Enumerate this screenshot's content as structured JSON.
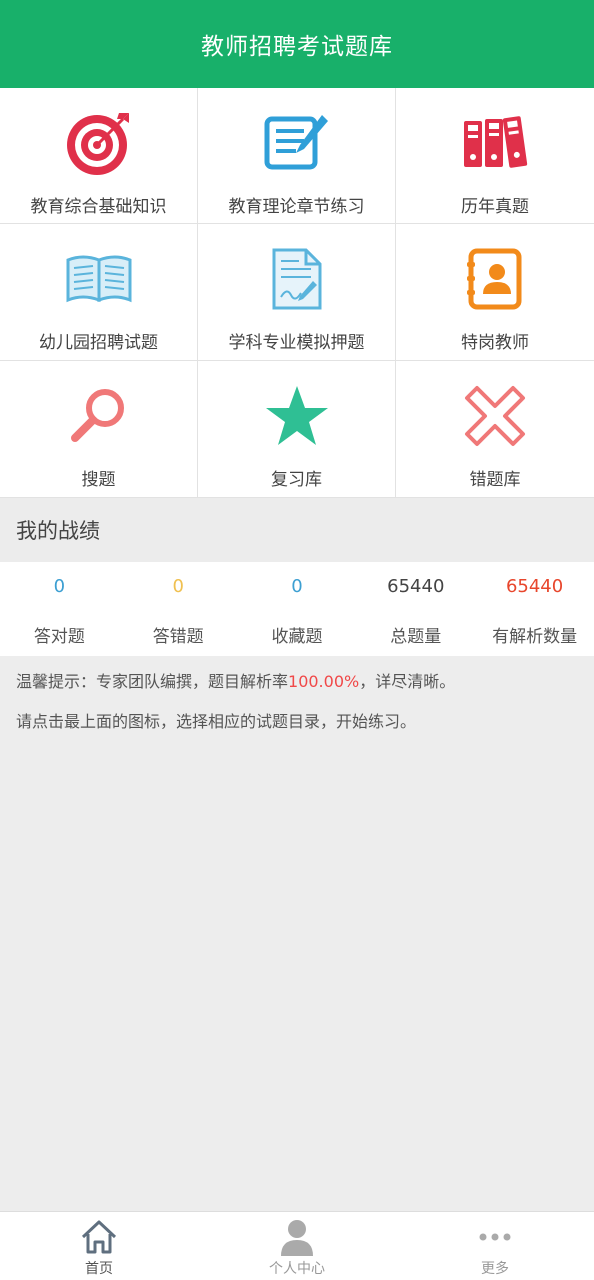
{
  "header": {
    "title": "教师招聘考试题库"
  },
  "grid": {
    "items": [
      {
        "label": "教育综合基础知识",
        "icon": "target-icon"
      },
      {
        "label": "教育理论章节练习",
        "icon": "notepad-pen-icon"
      },
      {
        "label": "历年真题",
        "icon": "binders-icon"
      },
      {
        "label": "幼儿园招聘试题",
        "icon": "open-book-icon"
      },
      {
        "label": "学科专业模拟押题",
        "icon": "document-pen-icon"
      },
      {
        "label": "特岗教师",
        "icon": "contact-book-icon"
      },
      {
        "label": "搜题",
        "icon": "magnifier-icon"
      },
      {
        "label": "复习库",
        "icon": "star-icon"
      },
      {
        "label": "错题库",
        "icon": "cross-icon"
      }
    ]
  },
  "record": {
    "title": "我的战绩",
    "stats": [
      {
        "value": "0",
        "label": "答对题",
        "color": "#3c9fd2"
      },
      {
        "value": "0",
        "label": "答错题",
        "color": "#f0c050"
      },
      {
        "value": "0",
        "label": "收藏题",
        "color": "#3c9fd2"
      },
      {
        "value": "65440",
        "label": "总题量",
        "color": "#444444"
      },
      {
        "value": "65440",
        "label": "有解析数量",
        "color": "#e8462c"
      }
    ]
  },
  "tips": {
    "line1_prefix": "温馨提示：专家团队编撰，题目解析率",
    "line1_rate": "100.00%",
    "line1_suffix": "，详尽清晰。",
    "line2": "请点击最上面的图标，选择相应的试题目录，开始练习。"
  },
  "tabbar": {
    "items": [
      {
        "label": "首页",
        "icon": "home-icon",
        "active": true
      },
      {
        "label": "个人中心",
        "icon": "person-icon",
        "active": false
      },
      {
        "label": "更多",
        "icon": "more-dots-icon",
        "active": false
      }
    ]
  },
  "colors": {
    "brand": "#18b06a",
    "accent_red": "#f04848"
  }
}
